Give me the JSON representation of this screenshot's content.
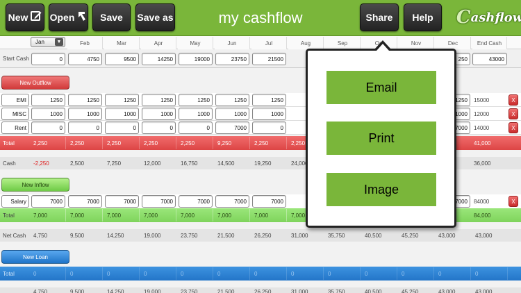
{
  "toolbar": {
    "new_label": "New",
    "open_label": "Open",
    "save_label": "Save",
    "saveas_label": "Save as",
    "title": "my cashflow",
    "share_label": "Share",
    "help_label": "Help",
    "logo_c": "C",
    "logo_rest": "ashflow"
  },
  "months_select": "Jan",
  "months": [
    "Feb",
    "Mar",
    "Apr",
    "May",
    "Jun",
    "Jul",
    "Aug",
    "Sep",
    "Oct",
    "Nov",
    "Dec"
  ],
  "end_cash_header": "End Cash",
  "start_cash": {
    "label": "Start Cash",
    "values": [
      "0",
      "4750",
      "9500",
      "14250",
      "19000",
      "23750",
      "21500"
    ],
    "partial": "250",
    "end": "43000"
  },
  "outflow": {
    "button": "New Outflow",
    "rows": [
      {
        "name": "EMI",
        "values": [
          "1250",
          "1250",
          "1250",
          "1250",
          "1250",
          "1250",
          "1250"
        ],
        "tail": "1250",
        "end": "15000"
      },
      {
        "name": "MISC",
        "values": [
          "1000",
          "1000",
          "1000",
          "1000",
          "1000",
          "1000",
          "1000"
        ],
        "tail": "1000",
        "end": "12000"
      },
      {
        "name": "Rent",
        "values": [
          "0",
          "0",
          "0",
          "0",
          "0",
          "7000",
          "0"
        ],
        "tail": "7000",
        "end": "14000"
      }
    ],
    "total_label": "Total",
    "total_values": [
      "2,250",
      "2,250",
      "2,250",
      "2,250",
      "2,250",
      "9,250",
      "2,250",
      "2,250"
    ],
    "total_end": "41,000"
  },
  "cash": {
    "label": "Cash",
    "values": [
      "-2,250",
      "2,500",
      "7,250",
      "12,000",
      "16,750",
      "14,500",
      "19,250",
      "24,000"
    ],
    "end": "36,000"
  },
  "inflow": {
    "button": "New Inflow",
    "row": {
      "name": "Salary",
      "values": [
        "7000",
        "7000",
        "7000",
        "7000",
        "7000",
        "7000",
        "7000"
      ],
      "tail": "7000",
      "end": "84000"
    },
    "total_label": "Total",
    "total_values": [
      "7,000",
      "7,000",
      "7,000",
      "7,000",
      "7,000",
      "7,000",
      "7,000",
      "7,000"
    ],
    "total_end": "84,000"
  },
  "netcash": {
    "label": "Net Cash",
    "values": [
      "4,750",
      "9,500",
      "14,250",
      "19,000",
      "23,750",
      "21,500",
      "26,250",
      "31,000",
      "35,750",
      "40,500",
      "45,250",
      "43,000",
      "43,000"
    ]
  },
  "loan": {
    "button": "New Loan",
    "total_label": "Total",
    "total_values": [
      "0",
      "0",
      "0",
      "0",
      "0",
      "0",
      "0",
      "0",
      "0",
      "0",
      "0",
      "0",
      "0"
    ]
  },
  "bottom": {
    "values": [
      "4,750",
      "9,500",
      "14,250",
      "19,000",
      "23,750",
      "21,500",
      "26,250",
      "31,000",
      "35,750",
      "40,500",
      "45,250",
      "43,000",
      "43,000"
    ]
  },
  "delete_label": "X",
  "share_menu": {
    "email": "Email",
    "print": "Print",
    "image": "Image"
  },
  "colors": {
    "topbar": "#7ab63a",
    "outflow_red": "#e0524f",
    "inflow_green": "#8fdc6c",
    "loan_blue": "#2f88d8"
  }
}
